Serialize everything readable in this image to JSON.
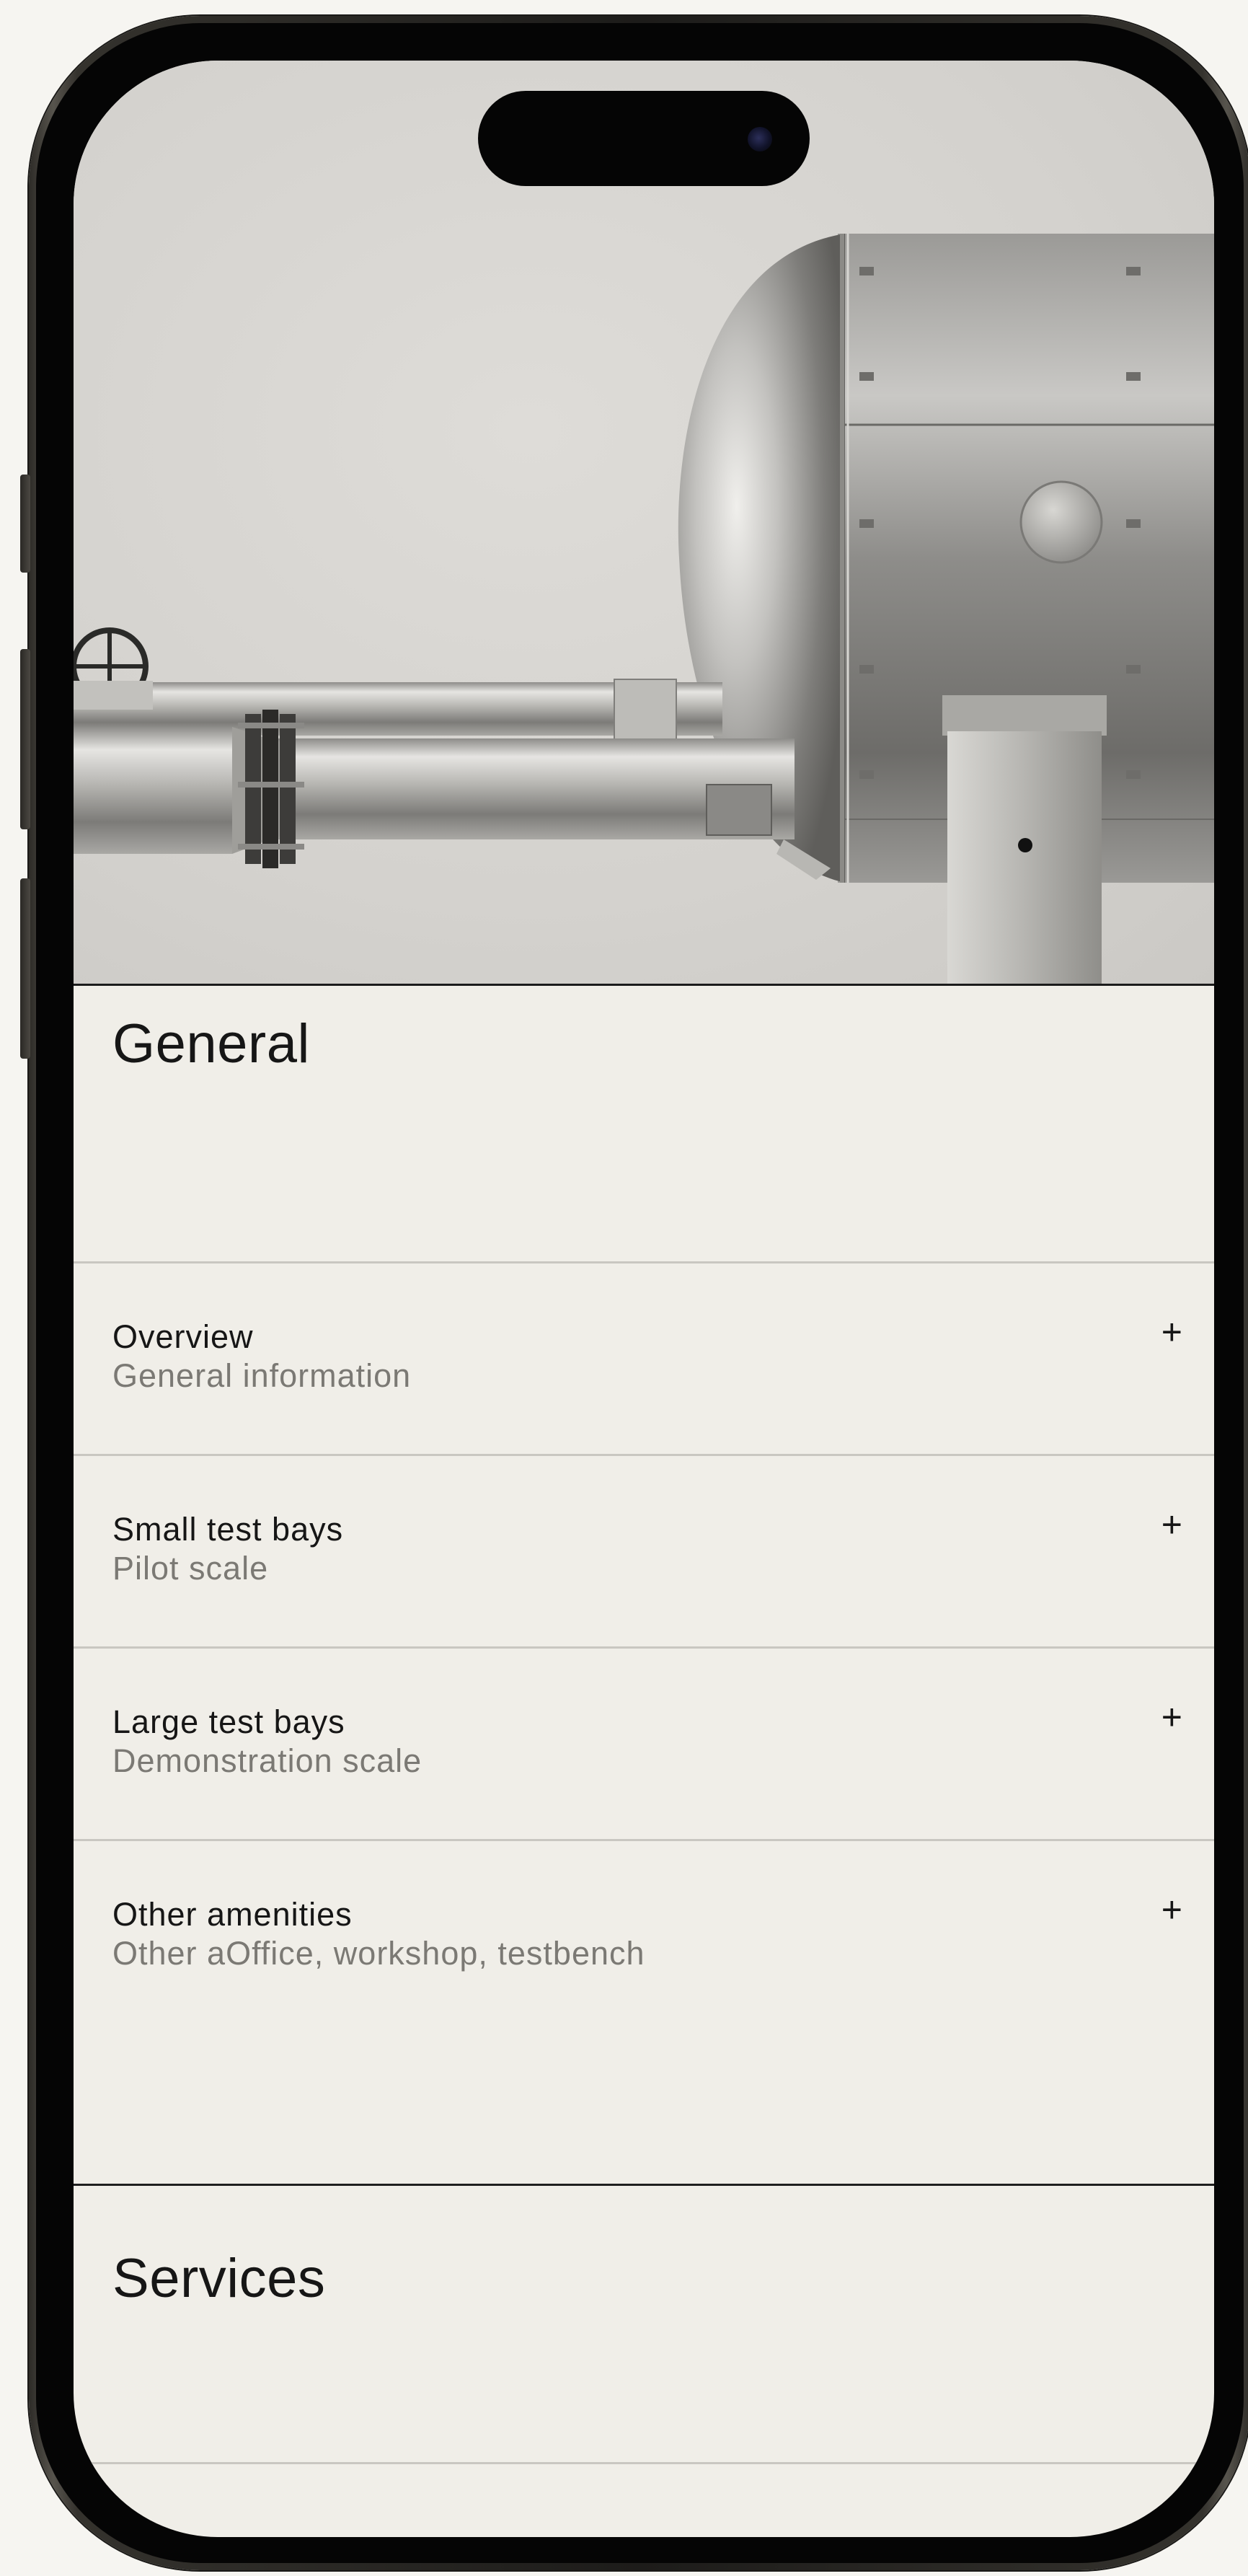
{
  "sections": {
    "general_title": "General",
    "services_title": "Services"
  },
  "accordion": [
    {
      "title": "Overview",
      "subtitle": "General information",
      "toggle": "+"
    },
    {
      "title": "Small test bays",
      "subtitle": "Pilot scale",
      "toggle": "+"
    },
    {
      "title": "Large test bays",
      "subtitle": "Demonstration scale",
      "toggle": "+"
    },
    {
      "title": "Other amenities",
      "subtitle": "Other aOffice, workshop, testbench",
      "toggle": "+"
    }
  ],
  "icons": {
    "toggle": "plus-icon",
    "hero": "pressure-vessel-illustration"
  },
  "colors": {
    "background": "#f0eee8",
    "text": "#161616",
    "muted": "#7b7974",
    "divider": "#c9c7c1"
  }
}
